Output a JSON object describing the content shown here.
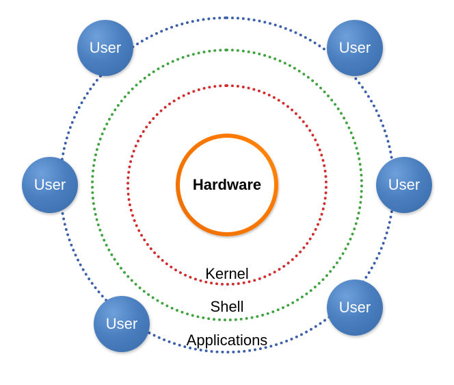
{
  "diagram": {
    "core": "Hardware",
    "rings": [
      {
        "key": "kernel",
        "label": "Kernel"
      },
      {
        "key": "shell",
        "label": "Shell"
      },
      {
        "key": "applications",
        "label": "Applications"
      }
    ],
    "user_label": "User",
    "user_count": 6,
    "colors": {
      "outer_ring": "#3b5fab",
      "mid_ring": "#3fa33f",
      "inner_ring": "#d12b2b",
      "core_accent": "#ff7a00",
      "user_fill": "#4a7fc0"
    }
  }
}
